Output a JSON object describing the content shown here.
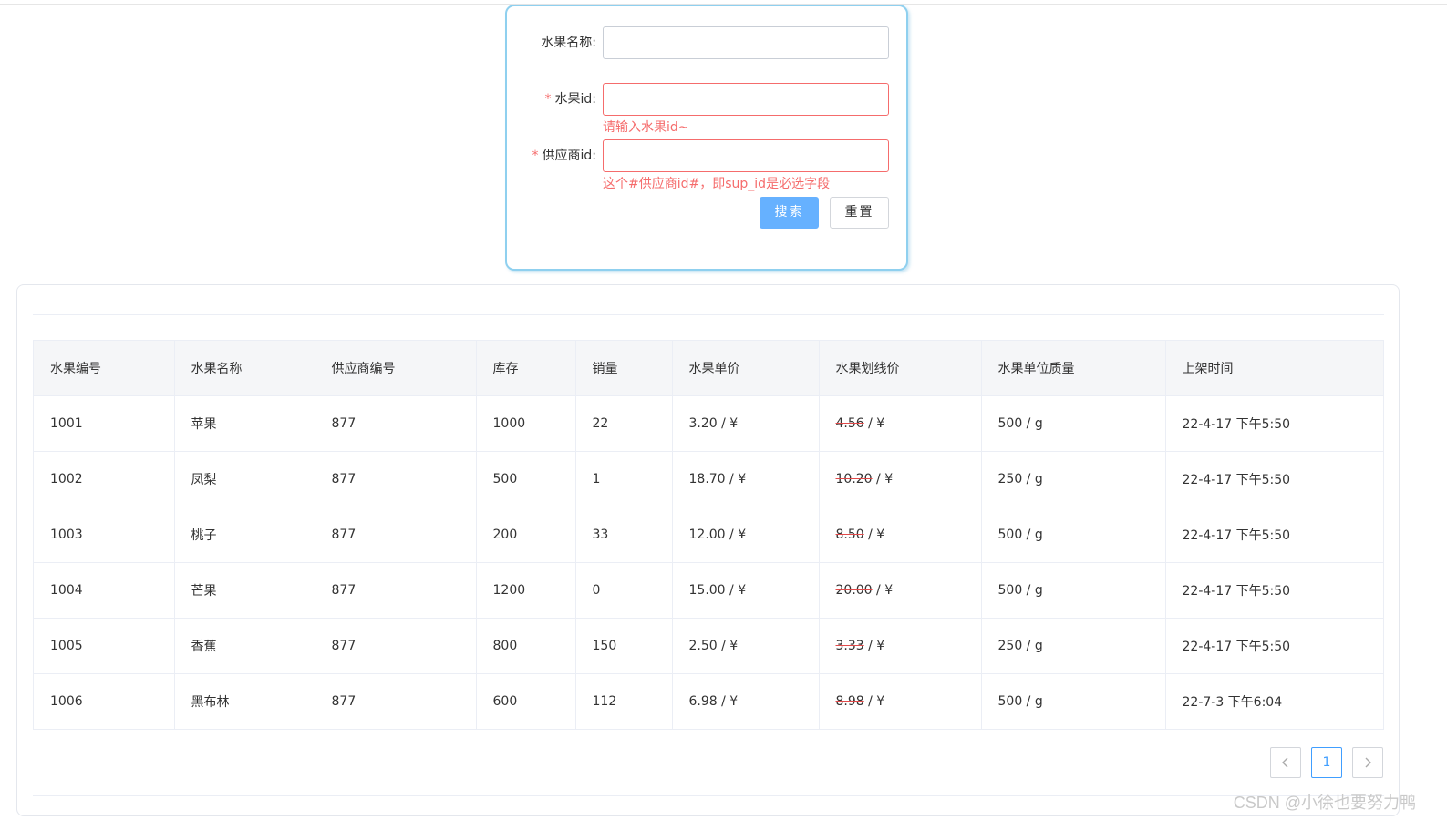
{
  "search_form": {
    "fruit_name_label": "水果名称:",
    "fruit_name_value": "",
    "fruit_id_required": "*",
    "fruit_id_label": "水果id:",
    "fruit_id_value": "",
    "fruit_id_error": "请输入水果id~",
    "supplier_id_required": "*",
    "supplier_id_label": "供应商id:",
    "supplier_id_value": "",
    "supplier_id_error": "这个#供应商id#，即sup_id是必选字段",
    "search_button": "搜索",
    "reset_button": "重置"
  },
  "table": {
    "columns": [
      "水果编号",
      "水果名称",
      "供应商编号",
      "库存",
      "销量",
      "水果单价",
      "水果划线价",
      "水果单位质量",
      "上架时间"
    ],
    "rows": [
      {
        "id": "1001",
        "name": "苹果",
        "supplier": "877",
        "stock": "1000",
        "sales": "22",
        "price": "3.20",
        "price_unit": " / ¥",
        "strike_price": "4.56",
        "strike_unit": " / ¥",
        "weight": "500 / g",
        "listed": "22-4-17 下午5:50"
      },
      {
        "id": "1002",
        "name": "凤梨",
        "supplier": "877",
        "stock": "500",
        "sales": "1",
        "price": "18.70",
        "price_unit": " / ¥",
        "strike_price": "10.20",
        "strike_unit": " / ¥",
        "weight": "250 / g",
        "listed": "22-4-17 下午5:50"
      },
      {
        "id": "1003",
        "name": "桃子",
        "supplier": "877",
        "stock": "200",
        "sales": "33",
        "price": "12.00",
        "price_unit": " / ¥",
        "strike_price": "8.50",
        "strike_unit": " / ¥",
        "weight": "500 / g",
        "listed": "22-4-17 下午5:50"
      },
      {
        "id": "1004",
        "name": "芒果",
        "supplier": "877",
        "stock": "1200",
        "sales": "0",
        "price": "15.00",
        "price_unit": " / ¥",
        "strike_price": "20.00",
        "strike_unit": " / ¥",
        "weight": "500 / g",
        "listed": "22-4-17 下午5:50"
      },
      {
        "id": "1005",
        "name": "香蕉",
        "supplier": "877",
        "stock": "800",
        "sales": "150",
        "price": "2.50",
        "price_unit": " / ¥",
        "strike_price": "3.33",
        "strike_unit": " / ¥",
        "weight": "250 / g",
        "listed": "22-4-17 下午5:50"
      },
      {
        "id": "1006",
        "name": "黑布林",
        "supplier": "877",
        "stock": "600",
        "sales": "112",
        "price": "6.98",
        "price_unit": " / ¥",
        "strike_price": "8.98",
        "strike_unit": " / ¥",
        "weight": "500 / g",
        "listed": "22-7-3 下午6:04"
      }
    ]
  },
  "pagination": {
    "prev_icon": "chevron-left-icon",
    "current_page": "1",
    "next_icon": "chevron-right-icon"
  },
  "watermark": "CSDN @小徐也要努力鸭",
  "colors": {
    "primary": "#66b1ff",
    "error": "#f56c6c",
    "card_border": "#8fd0ef",
    "active_page": "#409eff"
  }
}
